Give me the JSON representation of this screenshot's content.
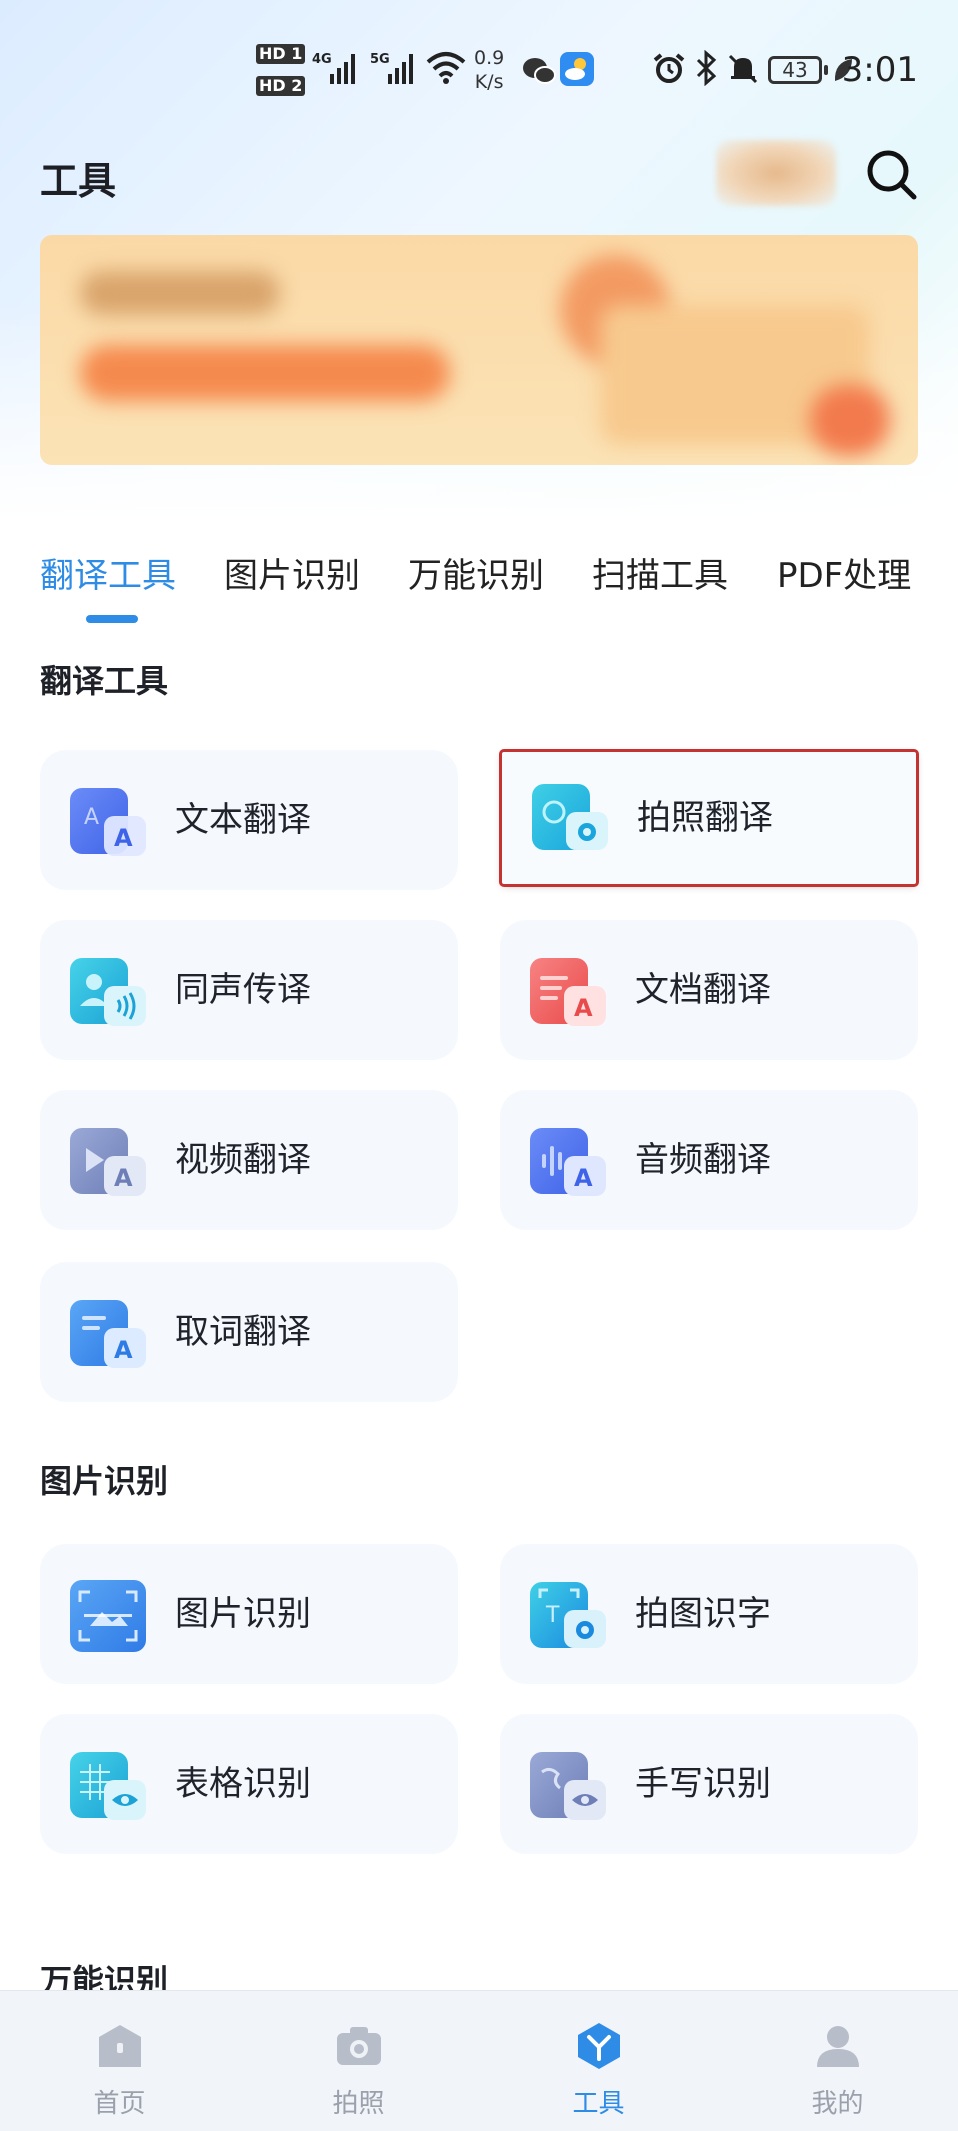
{
  "status_bar": {
    "sim1": "HD 1",
    "sim2": "HD 2",
    "net1": "4G",
    "net2": "5G",
    "speed_value": "0.9",
    "speed_unit": "K/s",
    "battery": "43",
    "time": "3:01"
  },
  "header": {
    "title": "工具"
  },
  "tabs": [
    {
      "label": "翻译工具",
      "active": true
    },
    {
      "label": "图片识别"
    },
    {
      "label": "万能识别"
    },
    {
      "label": "扫描工具"
    },
    {
      "label": "PDF处理"
    }
  ],
  "sections": {
    "translate": {
      "title": "翻译工具",
      "items": [
        {
          "label": "文本翻译",
          "icon": "text-translate-icon"
        },
        {
          "label": "拍照翻译",
          "icon": "photo-translate-icon"
        },
        {
          "label": "同声传译",
          "icon": "simultaneous-interpret-icon"
        },
        {
          "label": "文档翻译",
          "icon": "document-translate-icon"
        },
        {
          "label": "视频翻译",
          "icon": "video-translate-icon"
        },
        {
          "label": "音频翻译",
          "icon": "audio-translate-icon"
        },
        {
          "label": "取词翻译",
          "icon": "word-pick-translate-icon"
        }
      ]
    },
    "image_recognition": {
      "title": "图片识别",
      "items": [
        {
          "label": "图片识别",
          "icon": "image-recognition-icon"
        },
        {
          "label": "拍图识字",
          "icon": "photo-ocr-icon"
        },
        {
          "label": "表格识别",
          "icon": "table-recognition-icon"
        },
        {
          "label": "手写识别",
          "icon": "handwriting-recognition-icon"
        }
      ]
    },
    "universal": {
      "title": "万能识别"
    }
  },
  "bottom_nav": [
    {
      "label": "首页",
      "icon": "home-icon"
    },
    {
      "label": "拍照",
      "icon": "camera-icon"
    },
    {
      "label": "工具",
      "icon": "tools-icon",
      "active": true
    },
    {
      "label": "我的",
      "icon": "profile-icon"
    }
  ],
  "colors": {
    "accent": "#2e8ce6",
    "card_bg": "#f5f9fd",
    "nav_inactive": "#9aa1ac"
  }
}
